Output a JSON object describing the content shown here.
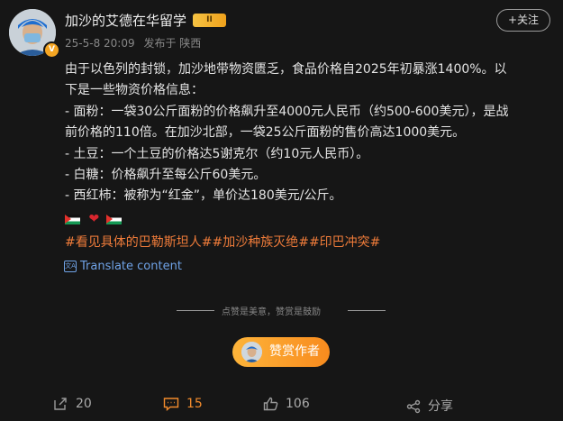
{
  "post": {
    "author": "加沙的艾德在华留学",
    "level_badge": "II",
    "verified_badge": "V",
    "time": "25-5-8 20:09",
    "source": "发布于 陕西",
    "follow_label": "+关注",
    "lines": [
      "由于以色列的封锁，加沙地带物资匮乏，食品价格自2025年初暴涨1400%。以",
      "下是一些物资价格信息：",
      "- 面粉：一袋30公斤面粉的价格飙升至4000元人民币（约500-600美元），是战",
      "前价格的110倍。在加沙北部，一袋25公斤面粉的售价高达1000美元。",
      "- 土豆：一个土豆的价格达5谢克尔（约10元人民币）。",
      "- 白糖：价格飙升至每公斤60美元。",
      "- 西红柿：被称为“红金”，单价达180美元/公斤。"
    ],
    "hashtags": [
      "#看见具体的巴勒斯坦人#",
      "#加沙种族灭绝#",
      "#印巴冲突#"
    ],
    "translate_label": "Translate content"
  },
  "reward": {
    "tip": "点赞是美意，赞赏是鼓励",
    "button_label": "赞赏作者"
  },
  "actions": {
    "repost_count": "20",
    "comment_count": "15",
    "like_count": "106",
    "share_label": "分享"
  },
  "colors": {
    "background": "#161616",
    "hashtag": "#f07c3a",
    "link": "#6fa2e6",
    "accent": "#f28b2c"
  },
  "icons": [
    "avatar",
    "verified-badge",
    "level-badge",
    "translate-icon",
    "palestine-flag-icon",
    "broken-heart-icon",
    "repost-icon",
    "comment-icon",
    "like-icon",
    "share-icon"
  ]
}
